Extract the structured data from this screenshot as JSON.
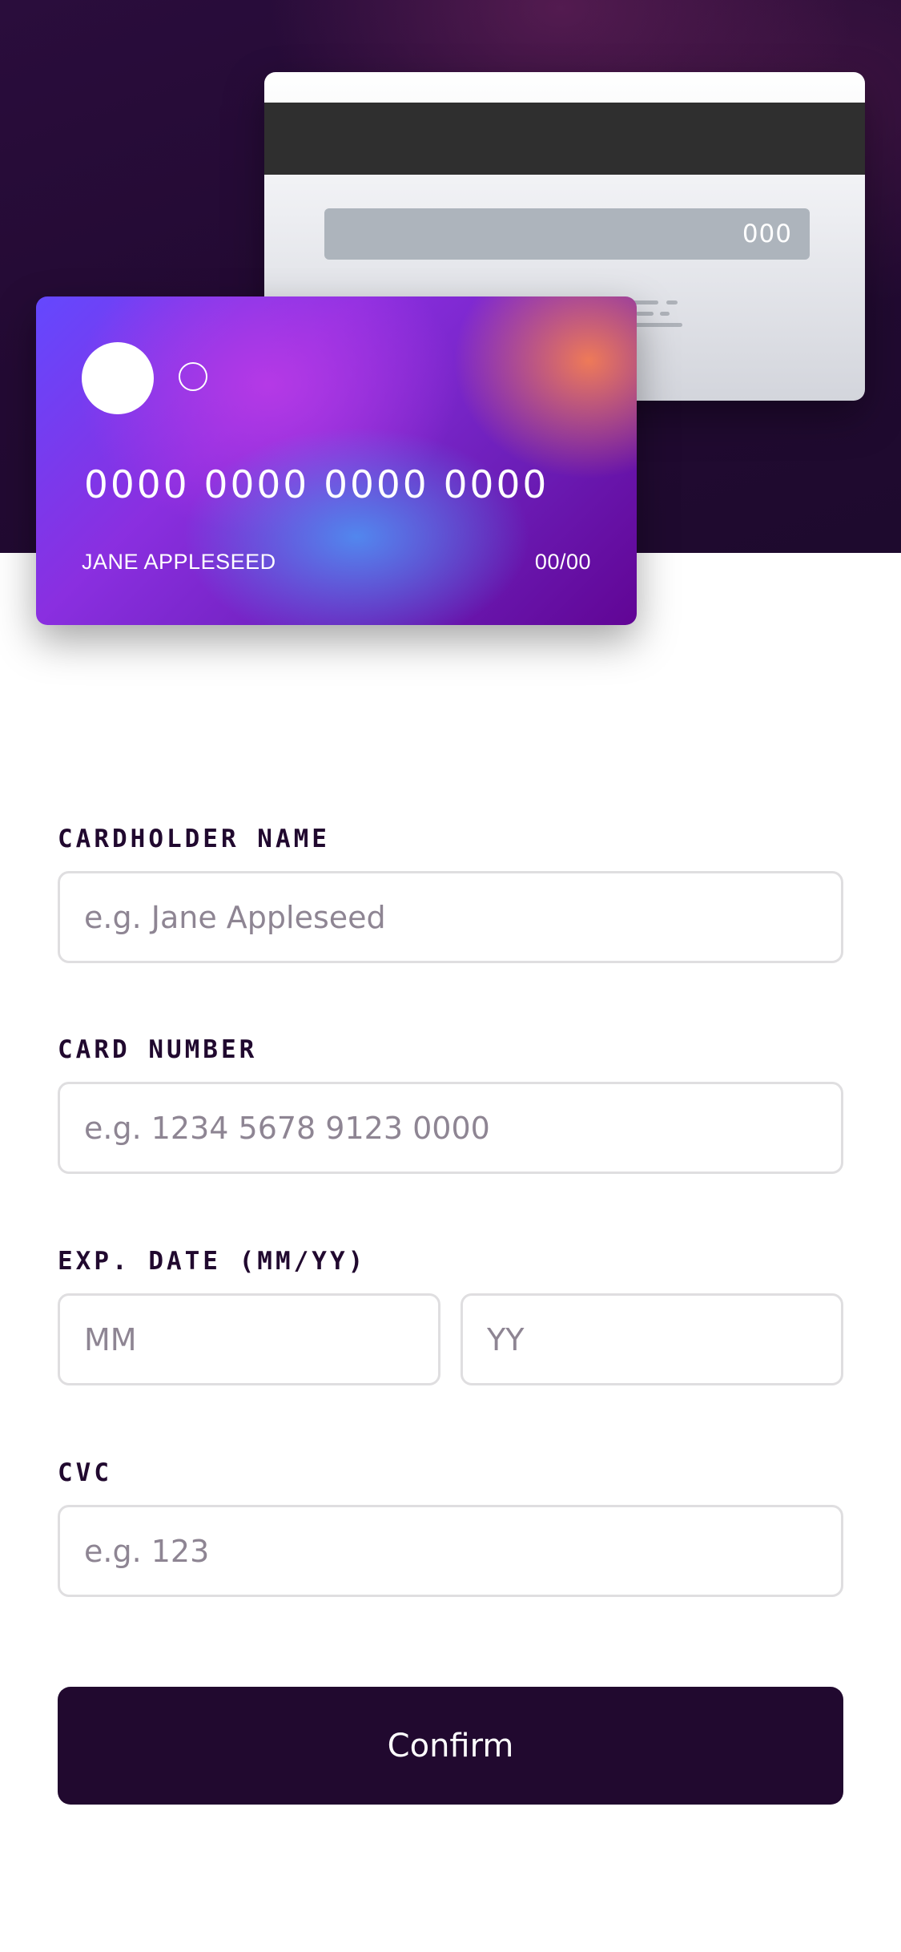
{
  "colors": {
    "dark_violet": "#21092f",
    "card_gradient_start": "#6448fe",
    "card_gradient_end": "#610595",
    "input_border": "#dfdee0",
    "placeholder": "#8e8593"
  },
  "card_back": {
    "cvc": "000"
  },
  "card_front": {
    "number": "0000 0000 0000 0000",
    "name": "JANE APPLESEED",
    "expiry": "00/00"
  },
  "form": {
    "cardholder_name": {
      "label": "CARDHOLDER NAME",
      "placeholder": "e.g. Jane Appleseed",
      "value": ""
    },
    "card_number": {
      "label": "CARD NUMBER",
      "placeholder": "e.g. 1234 5678 9123 0000",
      "value": ""
    },
    "exp_date": {
      "label": "EXP. DATE (MM/YY)",
      "month_placeholder": "MM",
      "year_placeholder": "YY"
    },
    "cvc": {
      "label": "CVC",
      "placeholder": "e.g. 123",
      "value": ""
    },
    "confirm_label": "Confirm"
  }
}
